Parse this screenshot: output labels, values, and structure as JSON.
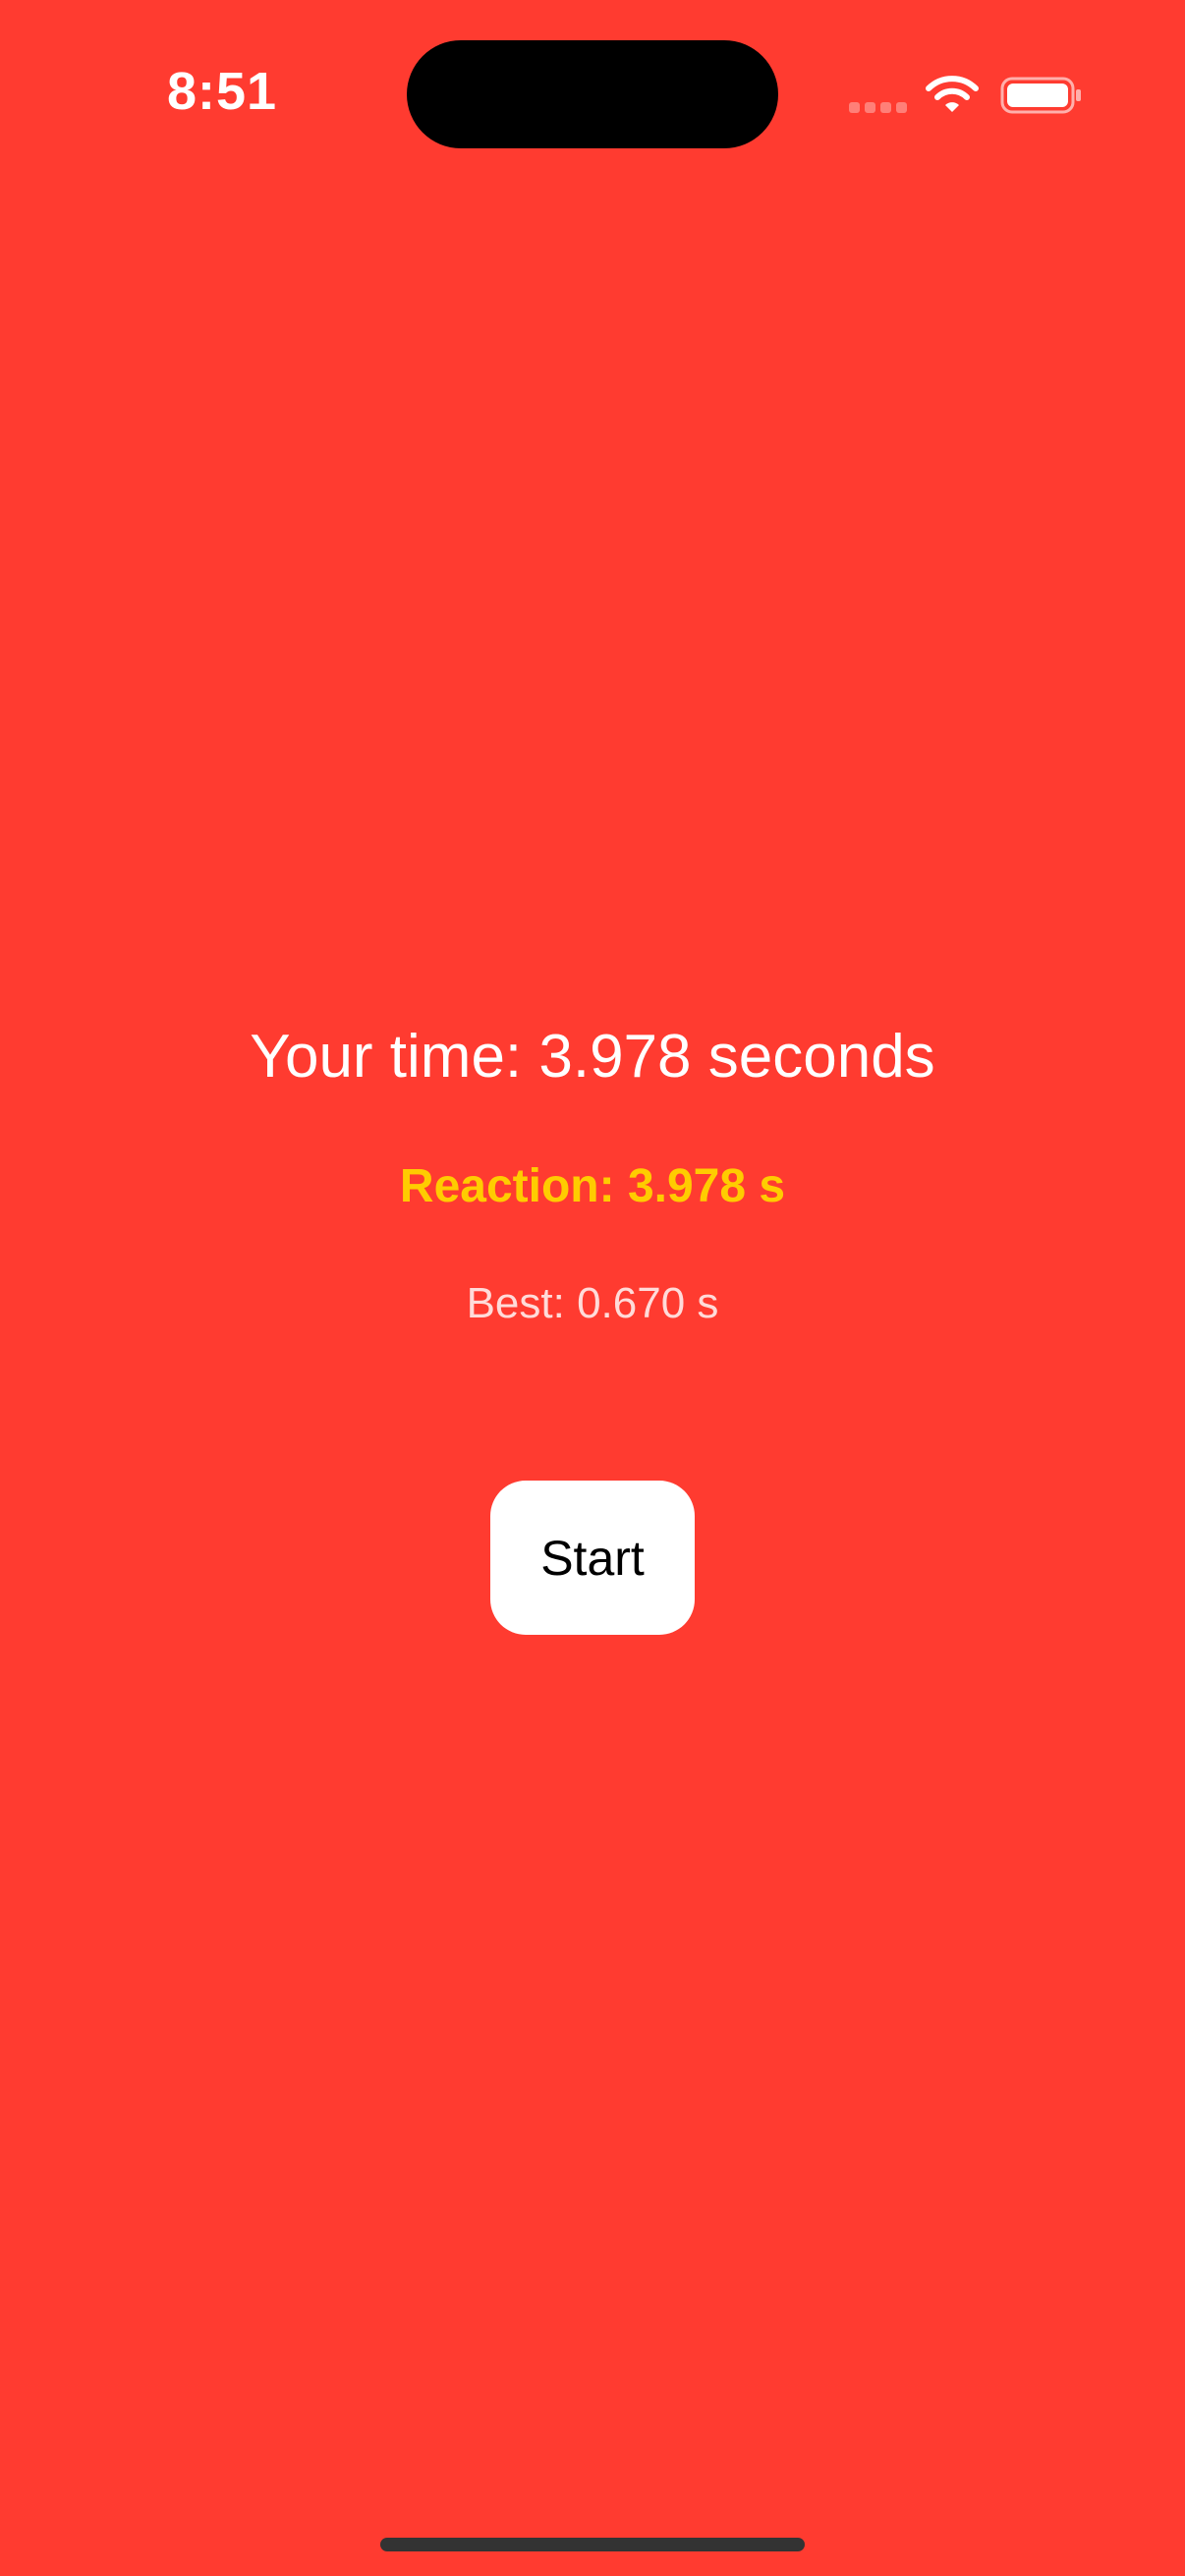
{
  "status_bar": {
    "time": "8:51",
    "icons": [
      "signal-icon",
      "wifi-icon",
      "battery-icon"
    ]
  },
  "game": {
    "your_time": "Your time: 3.978 seconds",
    "reaction": "Reaction: 3.978 s",
    "best": "Best: 0.670 s",
    "start_label": "Start"
  },
  "colors": {
    "background": "#FF3B30",
    "reaction_text": "#FFCC00",
    "button_background": "#FFFFFF",
    "primary_text": "#FFFFFF"
  }
}
